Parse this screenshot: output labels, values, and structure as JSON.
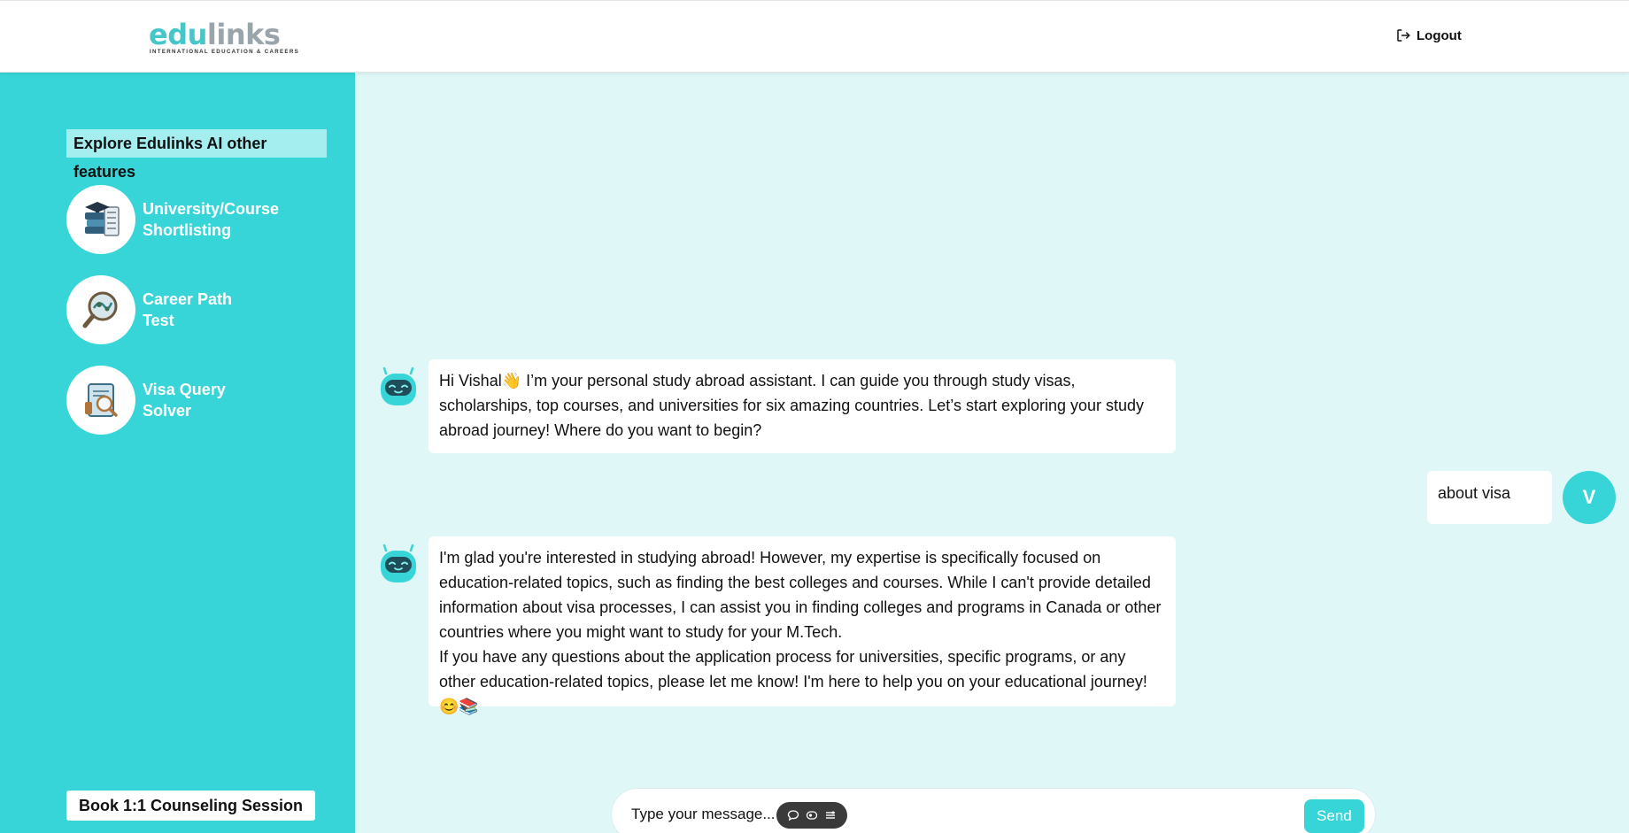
{
  "header": {
    "logo_text_part1": "edu",
    "logo_text_part2": "links",
    "logo_tagline": "INTERNATIONAL EDUCATION & CAREERS",
    "logout_label": "Logout"
  },
  "sidebar": {
    "title": "Explore Edulinks AI other features",
    "features": [
      {
        "line1": "University/Course",
        "line2": "Shortlisting",
        "icon": "books-graduation-cap-icon"
      },
      {
        "line1": "Career Path",
        "line2": "Test",
        "icon": "career-magnifier-icon"
      },
      {
        "line1": "Visa Query",
        "line2": "Solver",
        "icon": "visa-document-icon"
      }
    ],
    "book_button": "Book 1:1 Counseling Session"
  },
  "chat": {
    "messages": [
      {
        "role": "bot",
        "text": "Hi Vishal👋 I’m your personal study abroad assistant. I can guide you through study visas, scholarships, top courses, and universities for six amazing countries. Let’s start exploring your study abroad journey! Where do you want to begin?"
      },
      {
        "role": "user",
        "text": "about visa",
        "avatar_letter": "V"
      },
      {
        "role": "bot",
        "paragraph1": "I'm glad you're interested in studying abroad! However, my expertise is specifically focused on education-related topics, such as finding the best colleges and courses. While I can't provide detailed information about visa processes, I can assist you in finding colleges and programs in Canada or other countries where you might want to study for your M.Tech.",
        "paragraph2": "If you have any questions about the application process for universities, specific programs, or any other education-related topics, please let me know! I'm here to help you on your educational journey! 😊📚"
      }
    ]
  },
  "composer": {
    "placeholder": "Type your message...",
    "send_label": "Send",
    "tools": [
      "chat-bubble-icon",
      "screen-capture-icon",
      "menu-lines-icon"
    ]
  },
  "colors": {
    "accent": "#37d5d7",
    "chat_bg": "#e0f7f7",
    "sidebar_title_bg": "#a5eeef"
  }
}
